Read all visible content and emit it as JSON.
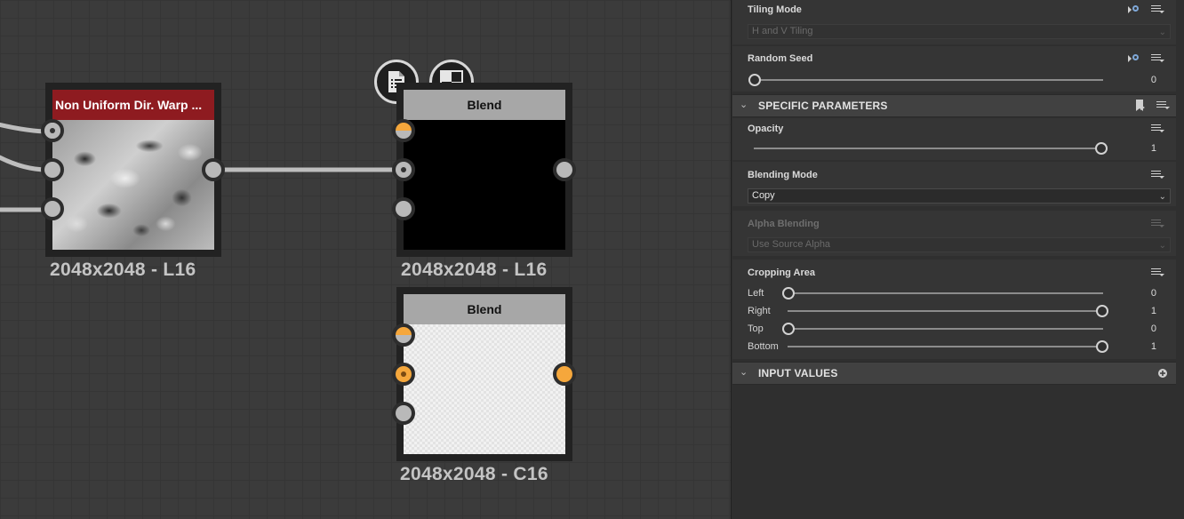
{
  "graph": {
    "node_warp": {
      "title": "Non Uniform Dir. Warp ...",
      "size_label": "2048x2048 - L16"
    },
    "node_blend_1": {
      "title": "Blend",
      "size_label": "2048x2048 - L16"
    },
    "node_blend_2": {
      "title": "Blend",
      "size_label": "2048x2048 - C16"
    },
    "buttons": {
      "doc_icon": "document-icon",
      "checker_icon": "checker-icon"
    },
    "colors": {
      "warp_header": "#8e1b20",
      "port_orange": "#f5a73c",
      "wire": "#bdbdbd"
    }
  },
  "panel": {
    "tiling_mode": {
      "label": "Tiling Mode",
      "value": "H and V Tiling"
    },
    "random_seed": {
      "label": "Random Seed",
      "value": "0",
      "level": 0
    },
    "specific_section": {
      "title": "SPECIFIC PARAMETERS"
    },
    "opacity": {
      "label": "Opacity",
      "value": "1",
      "level": 1
    },
    "blending_mode": {
      "label": "Blending Mode",
      "value": "Copy"
    },
    "alpha_blending": {
      "label": "Alpha Blending",
      "value": "Use Source Alpha"
    },
    "cropping": {
      "label": "Cropping Area",
      "left_label": "Left",
      "left_value": "0",
      "right_label": "Right",
      "right_value": "1",
      "top_label": "Top",
      "top_value": "0",
      "bottom_label": "Bottom",
      "bottom_value": "1"
    },
    "input_section": {
      "title": "INPUT VALUES"
    }
  }
}
